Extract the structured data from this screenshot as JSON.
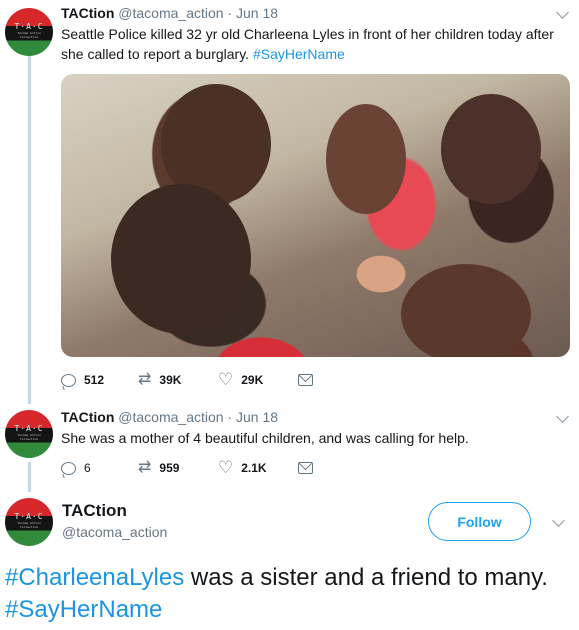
{
  "tweet1": {
    "name": "TACtion",
    "handle": "@tacoma_action",
    "sep": "·",
    "date": "Jun 18",
    "text_before": "Seattle Police killed 32 yr old Charleena Lyles in front of her children today after she called to report a burglary. ",
    "hashtag": "#SayHerName",
    "replies": "512",
    "retweets": "39K",
    "likes": "29K"
  },
  "tweet2": {
    "name": "TACtion",
    "handle": "@tacoma_action",
    "sep": "·",
    "date": "Jun 18",
    "text": "She was a mother of 4 beautiful children, and was calling for help.",
    "replies": "6",
    "retweets": "959",
    "likes": "2.1K"
  },
  "main": {
    "name": "TACtion",
    "handle": "@tacoma_action",
    "follow_label": "Follow",
    "hashtag1": "#CharleenaLyles",
    "text_middle": " was a sister and a friend to many. ",
    "hashtag2": "#SayHerName"
  },
  "avatar": {
    "logo_text": "T·A·C",
    "logo_sub": "Tacoma Action Collective"
  },
  "colors": {
    "link": "#1b95e0",
    "follow": "#1da1f2",
    "thread_line": "#c7d7e4",
    "muted": "#657786"
  },
  "icons": {
    "reply": "reply-icon",
    "retweet": "retweet-icon",
    "like": "heart-icon",
    "dm": "envelope-icon",
    "more": "chevron-down-icon"
  }
}
